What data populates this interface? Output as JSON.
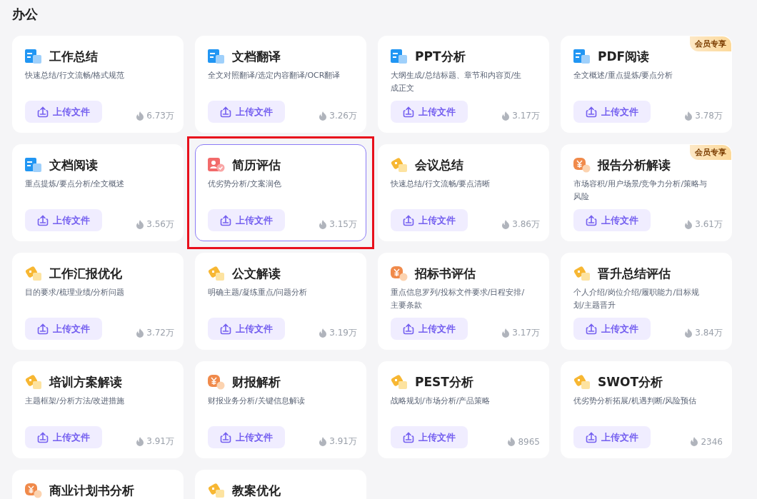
{
  "section_title": "办公",
  "cards": [
    {
      "kind": "doc",
      "title": "工作总结",
      "desc": "快速总结/行文流畅/格式规范",
      "button": "上传文件",
      "count": "6.73万",
      "selected": false
    },
    {
      "kind": "doc",
      "title": "文档翻译",
      "desc": "全文对照翻译/选定内容翻译/OCR翻译",
      "button": "上传文件",
      "count": "3.26万",
      "selected": false
    },
    {
      "kind": "doc",
      "title": "PPT分析",
      "desc": "大纲生成/总结标题、章节和内容页/生成正文",
      "button": "上传文件",
      "count": "3.17万",
      "selected": false
    },
    {
      "kind": "doc",
      "title": "PDF阅读",
      "desc": "全文概述/重点提炼/要点分析",
      "button": "上传文件",
      "count": "3.78万",
      "badge": "会员专享",
      "selected": false
    },
    {
      "kind": "doc",
      "title": "文档阅读",
      "desc": "重点提炼/要点分析/全文概述",
      "button": "上传文件",
      "count": "3.56万",
      "selected": false
    },
    {
      "kind": "resume",
      "title": "简历评估",
      "desc": "优劣势分析/文案润色",
      "button": "上传文件",
      "count": "3.15万",
      "selected": true
    },
    {
      "kind": "tag",
      "title": "会议总结",
      "desc": "快速总结/行文流畅/要点清晰",
      "button": "上传文件",
      "count": "3.86万",
      "selected": false
    },
    {
      "kind": "money",
      "title": "报告分析解读",
      "desc": "市场容积/用户场景/竞争力分析/策略与风险",
      "button": "上传文件",
      "count": "3.61万",
      "badge": "会员专享",
      "selected": false
    },
    {
      "kind": "tag",
      "title": "工作汇报优化",
      "desc": "目的要求/梳理业绩/分析问题",
      "button": "上传文件",
      "count": "3.72万",
      "selected": false
    },
    {
      "kind": "tag",
      "title": "公文解读",
      "desc": "明确主题/凝练重点/问题分析",
      "button": "上传文件",
      "count": "3.19万",
      "selected": false
    },
    {
      "kind": "money",
      "title": "招标书评估",
      "desc": "重点信息罗列/投标文件要求/日程安排/主要条款",
      "button": "上传文件",
      "count": "3.17万",
      "selected": false
    },
    {
      "kind": "tag",
      "title": "晋升总结评估",
      "desc": "个人介绍/岗位介绍/履职能力/目标规划/主题晋升",
      "button": "上传文件",
      "count": "3.84万",
      "selected": false
    },
    {
      "kind": "tag",
      "title": "培训方案解读",
      "desc": "主题框架/分析方法/改进措施",
      "button": "上传文件",
      "count": "3.91万",
      "selected": false
    },
    {
      "kind": "money",
      "title": "财报解析",
      "desc": "财报业务分析/关键信息解读",
      "button": "上传文件",
      "count": "3.91万",
      "selected": false
    },
    {
      "kind": "tag",
      "title": "PEST分析",
      "desc": "战略规划/市场分析/产品策略",
      "button": "上传文件",
      "count": "8965",
      "selected": false
    },
    {
      "kind": "tag",
      "title": "SWOT分析",
      "desc": "优劣势分析拓展/机遇判断/风险预估",
      "button": "上传文件",
      "count": "2346",
      "selected": false
    },
    {
      "kind": "money",
      "title": "商业计划书分析",
      "selected": false
    },
    {
      "kind": "tag",
      "title": "教案优化",
      "selected": false
    }
  ]
}
